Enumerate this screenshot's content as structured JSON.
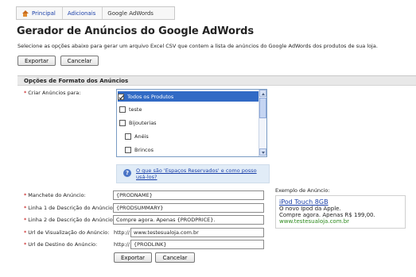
{
  "breadcrumb": {
    "items": [
      "Principal",
      "Adicionais",
      "Google AdWords"
    ]
  },
  "page": {
    "title": "Gerador de Anúncios do Google AdWords",
    "description": "Selecione as opções abaixo para gerar um arquivo Excel CSV que contem a lista de anúncios do Google AdWords dos produtos de sua loja."
  },
  "top_buttons": {
    "export": "Exportar",
    "cancel": "Cancelar"
  },
  "section": {
    "title": "Opções de Formato dos Anúncios"
  },
  "create_for": {
    "label": "Criar Anúncios para:",
    "options": [
      {
        "label": "Todos os Produtos",
        "checked": true,
        "selected": true
      },
      {
        "label": "teste",
        "checked": false
      },
      {
        "label": "Bijouterias",
        "checked": false
      },
      {
        "label": "Anéis",
        "checked": false
      },
      {
        "label": "Brincos",
        "checked": false
      }
    ]
  },
  "help": {
    "text": "O que são 'Espaços Reservados' e como posso usá-los?"
  },
  "fields": [
    {
      "label": "Manchete do Anúncio:",
      "prefix": "",
      "value": "{PRODNAME}"
    },
    {
      "label": "Linha 1 de Descrição do Anúncio:",
      "prefix": "",
      "value": "{PRODSUMMARY}"
    },
    {
      "label": "Linha 2 de Descrição do Anúncio:",
      "prefix": "",
      "value": "Compre agora. Apenas {PRODPRICE}."
    },
    {
      "label": "Url de Visualização do Anúncio:",
      "prefix": "http://",
      "value": "www.testesualoja.com.br"
    },
    {
      "label": "Url de Destino do Anúncio:",
      "prefix": "http://",
      "value": "{PRODLINK}"
    }
  ],
  "example": {
    "label": "Exemplo de Anúncio:",
    "title": "iPod Touch 8GB",
    "line1": "O novo Ipod da Apple.",
    "line2": "Compre agora. Apenas R$ 199,00.",
    "url": "www.testesualoja.com.br"
  },
  "bottom_buttons": {
    "export": "Exportar",
    "cancel": "Cancelar"
  },
  "colors": {
    "link": "#1a3fa8",
    "required": "#c00000",
    "selected_row": "#316ac5",
    "ad_url": "#2e8b1e"
  }
}
